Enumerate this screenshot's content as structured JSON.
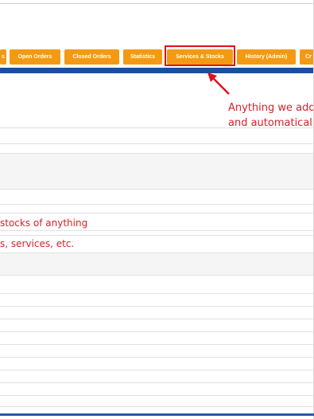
{
  "tabs": [
    {
      "label": "s"
    },
    {
      "label": "Open Orders"
    },
    {
      "label": "Closed Orders"
    },
    {
      "label": "Statistics"
    },
    {
      "label": "Services & Stocks"
    },
    {
      "label": "History (Admin)"
    },
    {
      "label": "Cr"
    }
  ],
  "annotation": {
    "line1": "Anything we add",
    "line2": "and automaticall"
  },
  "body_text": {
    "line1": "stocks of anything",
    "line2": "s, services, etc."
  },
  "colors": {
    "tab_orange": "#f39a12",
    "highlight_red": "#e0101a",
    "nav_blue": "#1a4ea0",
    "annotation_red": "#d8202a"
  }
}
